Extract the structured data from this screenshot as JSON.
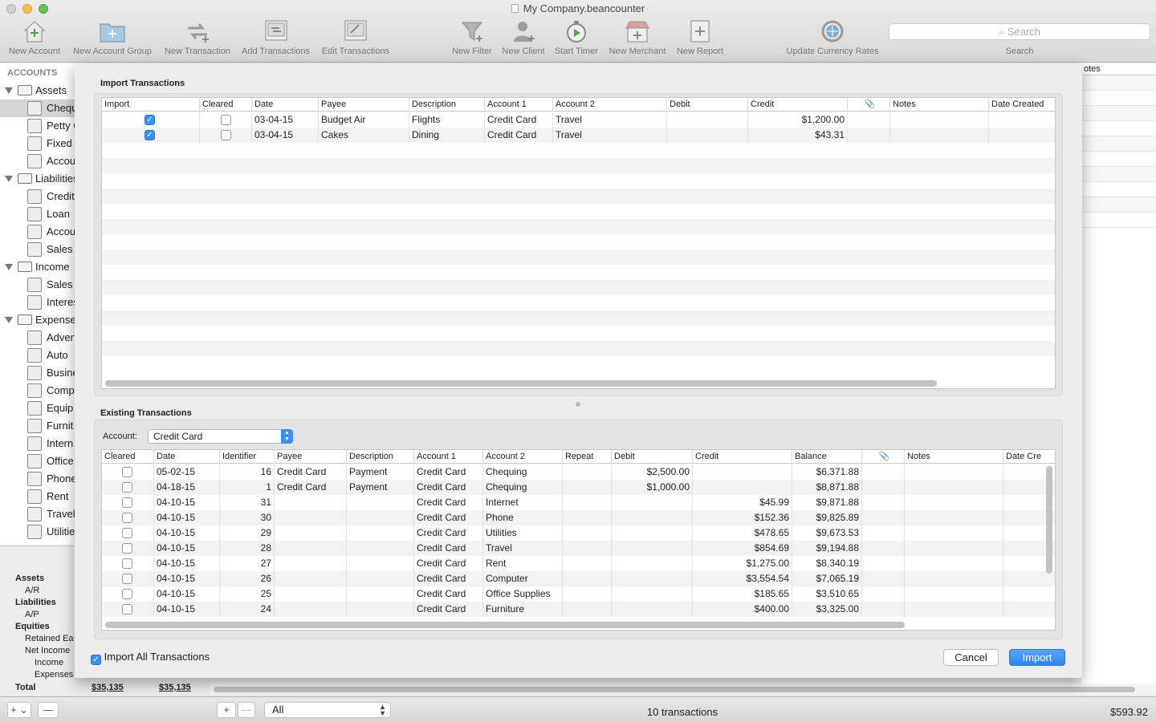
{
  "window": {
    "title": "My Company.beancounter"
  },
  "toolbar": {
    "items": [
      {
        "label": "New Account"
      },
      {
        "label": "New Account Group"
      },
      {
        "label": "New Transaction"
      },
      {
        "label": "Add Transactions"
      },
      {
        "label": "Edit Transactions"
      },
      {
        "label": "New Filter"
      },
      {
        "label": "New Client"
      },
      {
        "label": "Start Timer"
      },
      {
        "label": "New Merchant"
      },
      {
        "label": "New Report"
      },
      {
        "label": "Update Currency Rates"
      }
    ],
    "search_placeholder": "Search",
    "search_label": "Search"
  },
  "sidebar": {
    "header": "ACCOUNTS",
    "rows": [
      {
        "label": "Assets",
        "group": true
      },
      {
        "label": "Chequ",
        "group": false,
        "selected": true
      },
      {
        "label": "Petty C",
        "group": false
      },
      {
        "label": "Fixed",
        "group": false
      },
      {
        "label": "Accou",
        "group": false
      },
      {
        "label": "Liabilities",
        "group": true
      },
      {
        "label": "Credit",
        "group": false
      },
      {
        "label": "Loan",
        "group": false
      },
      {
        "label": "Accou",
        "group": false
      },
      {
        "label": "Sales",
        "group": false
      },
      {
        "label": "Income",
        "group": true
      },
      {
        "label": "Sales",
        "group": false
      },
      {
        "label": "Interes",
        "group": false
      },
      {
        "label": "Expense",
        "group": true
      },
      {
        "label": "Advert",
        "group": false
      },
      {
        "label": "Auto",
        "group": false
      },
      {
        "label": "Busine",
        "group": false
      },
      {
        "label": "Comp",
        "group": false
      },
      {
        "label": "Equip",
        "group": false
      },
      {
        "label": "Furnit",
        "group": false
      },
      {
        "label": "Intern",
        "group": false
      },
      {
        "label": "Office",
        "group": false
      },
      {
        "label": "Phone",
        "group": false
      },
      {
        "label": "Rent",
        "group": false
      },
      {
        "label": "Travel",
        "group": false
      },
      {
        "label": "Utilitie",
        "group": false
      }
    ]
  },
  "summary": {
    "rows": [
      {
        "label": "Assets",
        "bold": true,
        "indent": 0
      },
      {
        "label": "A/R",
        "bold": false,
        "indent": 1
      },
      {
        "label": "Liabilities",
        "bold": true,
        "indent": 0
      },
      {
        "label": "A/P",
        "bold": false,
        "indent": 1
      },
      {
        "label": "Equities",
        "bold": true,
        "indent": 0
      },
      {
        "label": "Retained Ea",
        "bold": false,
        "indent": 1
      },
      {
        "label": "Net Income",
        "bold": false,
        "indent": 1
      },
      {
        "label": "Income",
        "bold": false,
        "indent": 2
      },
      {
        "label": "Expenses",
        "bold": false,
        "indent": 2
      }
    ],
    "total_label": "Total",
    "total_a": "$35,135",
    "total_b": "$35,135"
  },
  "background": {
    "notes_header": "otes"
  },
  "bottombar": {
    "add_label": "+ ⌄",
    "remove_label": "—",
    "add2_label": "+",
    "remove2_label": "—",
    "filter_value": "All",
    "count": "10 transactions",
    "total": "$593.92"
  },
  "sheet": {
    "import_title": "Import Transactions",
    "import_columns": [
      "Import",
      "Cleared",
      "Date",
      "Payee",
      "Description",
      "Account 1",
      "Account 2",
      "Debit",
      "Credit",
      "",
      "Notes",
      "Date Created"
    ],
    "import_rows": [
      {
        "import": true,
        "cleared": false,
        "date": "03-04-15",
        "payee": "Budget Air",
        "description": "Flights",
        "account1": "Credit Card",
        "account2": "Travel",
        "debit": "",
        "credit": "$1,200.00",
        "notes": "",
        "created": ""
      },
      {
        "import": true,
        "cleared": false,
        "date": "03-04-15",
        "payee": "Cakes",
        "description": "Dining",
        "account1": "Credit Card",
        "account2": "Travel",
        "debit": "",
        "credit": "$43.31",
        "notes": "",
        "created": ""
      }
    ],
    "existing_title": "Existing Transactions",
    "account_label": "Account:",
    "account_value": "Credit Card",
    "existing_columns": [
      "Cleared",
      "Date",
      "Identifier",
      "Payee",
      "Description",
      "Account 1",
      "Account 2",
      "Repeat",
      "Debit",
      "Credit",
      "Balance",
      "",
      "Notes",
      "Date Cre"
    ],
    "existing_rows": [
      {
        "date": "05-02-15",
        "id": "16",
        "payee": "Credit Card",
        "description": "Payment",
        "account1": "Credit Card",
        "account2": "Chequing",
        "debit": "$2,500.00",
        "credit": "",
        "balance": "$6,371.88"
      },
      {
        "date": "04-18-15",
        "id": "1",
        "payee": "Credit Card",
        "description": "Payment",
        "account1": "Credit Card",
        "account2": "Chequing",
        "debit": "$1,000.00",
        "credit": "",
        "balance": "$8,871.88"
      },
      {
        "date": "04-10-15",
        "id": "31",
        "payee": "",
        "description": "",
        "account1": "Credit Card",
        "account2": "Internet",
        "debit": "",
        "credit": "$45.99",
        "balance": "$9,871.88"
      },
      {
        "date": "04-10-15",
        "id": "30",
        "payee": "",
        "description": "",
        "account1": "Credit Card",
        "account2": "Phone",
        "debit": "",
        "credit": "$152.36",
        "balance": "$9,825.89"
      },
      {
        "date": "04-10-15",
        "id": "29",
        "payee": "",
        "description": "",
        "account1": "Credit Card",
        "account2": "Utilities",
        "debit": "",
        "credit": "$478.65",
        "balance": "$9,673.53"
      },
      {
        "date": "04-10-15",
        "id": "28",
        "payee": "",
        "description": "",
        "account1": "Credit Card",
        "account2": "Travel",
        "debit": "",
        "credit": "$854.69",
        "balance": "$9,194.88"
      },
      {
        "date": "04-10-15",
        "id": "27",
        "payee": "",
        "description": "",
        "account1": "Credit Card",
        "account2": "Rent",
        "debit": "",
        "credit": "$1,275.00",
        "balance": "$8,340.19"
      },
      {
        "date": "04-10-15",
        "id": "26",
        "payee": "",
        "description": "",
        "account1": "Credit Card",
        "account2": "Computer",
        "debit": "",
        "credit": "$3,554.54",
        "balance": "$7,065.19"
      },
      {
        "date": "04-10-15",
        "id": "25",
        "payee": "",
        "description": "",
        "account1": "Credit Card",
        "account2": "Office Supplies",
        "debit": "",
        "credit": "$185.65",
        "balance": "$3,510.65"
      },
      {
        "date": "04-10-15",
        "id": "24",
        "payee": "",
        "description": "",
        "account1": "Credit Card",
        "account2": "Furniture",
        "debit": "",
        "credit": "$400.00",
        "balance": "$3,325.00"
      }
    ],
    "import_all_label": "Import All Transactions",
    "import_all_checked": true,
    "cancel_label": "Cancel",
    "import_label": "Import"
  }
}
